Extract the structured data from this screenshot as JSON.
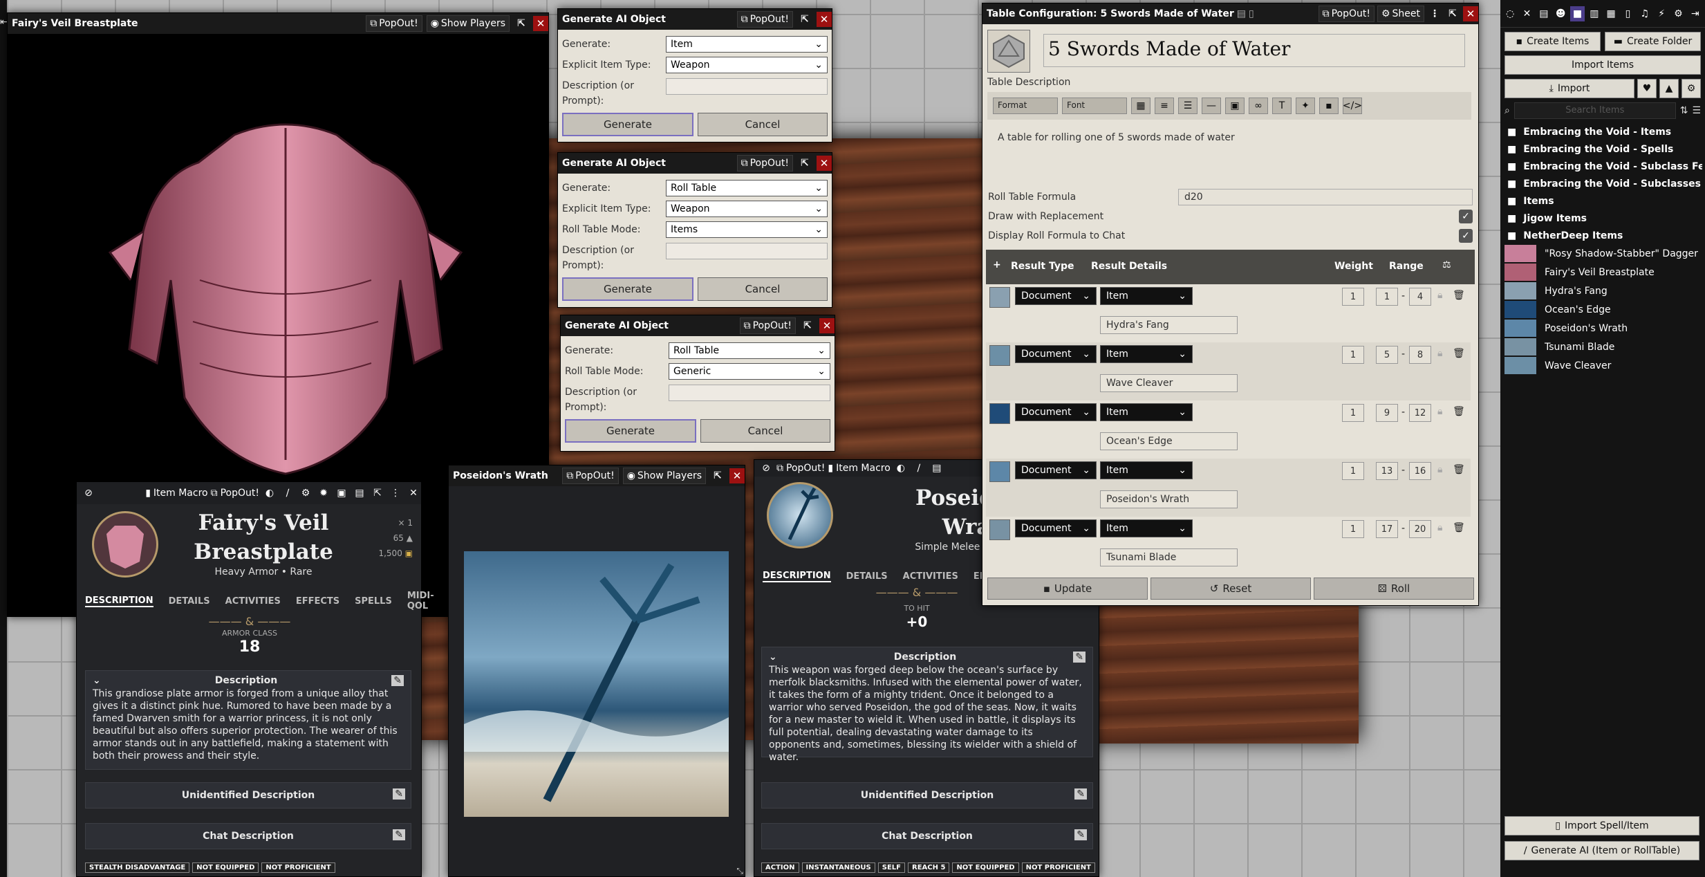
{
  "fairy_popout": {
    "title": "Fairy's Veil Breastplate",
    "popout": "PopOut!",
    "show_players": "Show Players"
  },
  "gen1": {
    "title": "Generate AI Object",
    "popout": "PopOut!",
    "generate_label": "Generate:",
    "generate_value": "Item",
    "type_label": "Explicit Item Type:",
    "type_value": "Weapon",
    "desc_label": "Description (or",
    "desc_label2": "Prompt):",
    "btn_generate": "Generate",
    "btn_cancel": "Cancel"
  },
  "gen2": {
    "title": "Generate AI Object",
    "popout": "PopOut!",
    "generate_label": "Generate:",
    "generate_value": "Roll Table",
    "type_label": "Explicit Item Type:",
    "type_value": "Weapon",
    "mode_label": "Roll Table Mode:",
    "mode_value": "Items",
    "desc_label": "Description (or",
    "desc_label2": "Prompt):",
    "btn_generate": "Generate",
    "btn_cancel": "Cancel"
  },
  "gen3": {
    "title": "Generate AI Object",
    "popout": "PopOut!",
    "generate_label": "Generate:",
    "generate_value": "Roll Table",
    "mode_label": "Roll Table Mode:",
    "mode_value": "Generic",
    "desc_label": "Description (or",
    "desc_label2": "Prompt):",
    "btn_generate": "Generate",
    "btn_cancel": "Cancel"
  },
  "fairy_sheet": {
    "macro": "Item Macro",
    "popout": "PopOut!",
    "name_line1": "Fairy's Veil",
    "name_line2": "Breastplate",
    "subtitle": "Heavy Armor • Rare",
    "qty": "× 1",
    "weight": "65",
    "price": "1,500",
    "tabs": [
      "DESCRIPTION",
      "DETAILS",
      "ACTIVITIES",
      "EFFECTS",
      "SPELLS",
      "MIDI-QOL"
    ],
    "stat_label": "ARMOR CLASS",
    "stat_value": "18",
    "desc_title": "Description",
    "desc_text": "This grandiose plate armor is forged from a unique alloy that gives it a distinct pink hue. Rumored to have been made by a famed Dwarven smith for a warrior princess, it is not only beautiful but also offers superior protection. The wearer of this armor stands out in any battlefield, making a statement with both their prowess and their style.",
    "unidentified": "Unidentified Description",
    "chat": "Chat Description",
    "pills": [
      "STEALTH DISADVANTAGE",
      "NOT EQUIPPED",
      "NOT PROFICIENT"
    ]
  },
  "poseidon_popout": {
    "title": "Poseidon's Wrath",
    "popout": "PopOut!",
    "show_players": "Show Players"
  },
  "poseidon_sheet": {
    "popout": "PopOut!",
    "macro": "Item Macro",
    "name_line1": "Poseidon's",
    "name_line2": "Wrath",
    "subtitle": "Simple Melee • Legendary",
    "tabs": [
      "DESCRIPTION",
      "DETAILS",
      "ACTIVITIES",
      "EFFECTS"
    ],
    "stat_label": "TO HIT",
    "stat_value": "+0",
    "desc_title": "Description",
    "desc_text": "This weapon was forged deep below the ocean's surface by merfolk blacksmiths. Infused with the elemental power of water, it takes the form of a mighty trident. Once it belonged to a warrior who served Poseidon, the god of the seas. Now, it waits for a new master to wield it. When used in battle, it displays its full potential, dealing devastating water damage to its opponents and, sometimes, blessing its wielder with a shield of water.",
    "unidentified": "Unidentified Description",
    "chat": "Chat Description",
    "pills": [
      "ACTION",
      "INSTANTANEOUS",
      "SELF",
      "REACH 5",
      "NOT EQUIPPED",
      "NOT PROFICIENT"
    ]
  },
  "table_config": {
    "title": "Table Configuration: 5 Swords Made of Water",
    "popout": "PopOut!",
    "sheet": "Sheet",
    "name": "5 Swords Made of Water",
    "desc_label": "Table Description",
    "format": "Format",
    "font": "Font",
    "description": "A table for rolling one of 5 swords made of water",
    "formula_label": "Roll Table Formula",
    "formula": "d20",
    "replacement_label": "Draw with Replacement",
    "display_label": "Display Roll Formula to Chat",
    "col_type": "Result Type",
    "col_details": "Result Details",
    "col_weight": "Weight",
    "col_range": "Range",
    "results": [
      {
        "type": "Document",
        "kind": "Item",
        "name": "Hydra's Fang",
        "weight": "1",
        "lo": "1",
        "hi": "4",
        "thumb": "#8aa0b0"
      },
      {
        "type": "Document",
        "kind": "Item",
        "name": "Wave Cleaver",
        "weight": "1",
        "lo": "5",
        "hi": "8",
        "thumb": "#6c8fa6"
      },
      {
        "type": "Document",
        "kind": "Item",
        "name": "Ocean's Edge",
        "weight": "1",
        "lo": "9",
        "hi": "12",
        "thumb": "#1f4b78"
      },
      {
        "type": "Document",
        "kind": "Item",
        "name": "Poseidon's Wrath",
        "weight": "1",
        "lo": "13",
        "hi": "16",
        "thumb": "#5d87a8"
      },
      {
        "type": "Document",
        "kind": "Item",
        "name": "Tsunami Blade",
        "weight": "1",
        "lo": "17",
        "hi": "20",
        "thumb": "#7892a3"
      }
    ],
    "btn_update": "Update",
    "btn_reset": "Reset",
    "btn_roll": "Roll"
  },
  "sidebar": {
    "create_item": "Create Items",
    "create_folder": "Create Folder",
    "import_items": "Import Items",
    "import": "Import",
    "search_placeholder": "Search Items",
    "folders": [
      "Embracing the Void - Items",
      "Embracing the Void - Spells",
      "Embracing the Void - Subclass Features",
      "Embracing the Void - Subclasses",
      "Items",
      "Jigow Items",
      "NetherDeep Items"
    ],
    "entries": [
      {
        "name": "\"Rosy Shadow-Stabber\" Dagger",
        "color": "#c87f9a"
      },
      {
        "name": "Fairy's Veil Breastplate",
        "color": "#b06075"
      },
      {
        "name": "Hydra's Fang",
        "color": "#8aa0b0"
      },
      {
        "name": "Ocean's Edge",
        "color": "#1f4b78"
      },
      {
        "name": "Poseidon's Wrath",
        "color": "#5d87a8"
      },
      {
        "name": "Tsunami Blade",
        "color": "#7892a3"
      },
      {
        "name": "Wave Cleaver",
        "color": "#6c8fa6"
      }
    ],
    "import_spell": "Import Spell/Item",
    "generate_ai": "Generate AI (Item or RollTable)"
  }
}
